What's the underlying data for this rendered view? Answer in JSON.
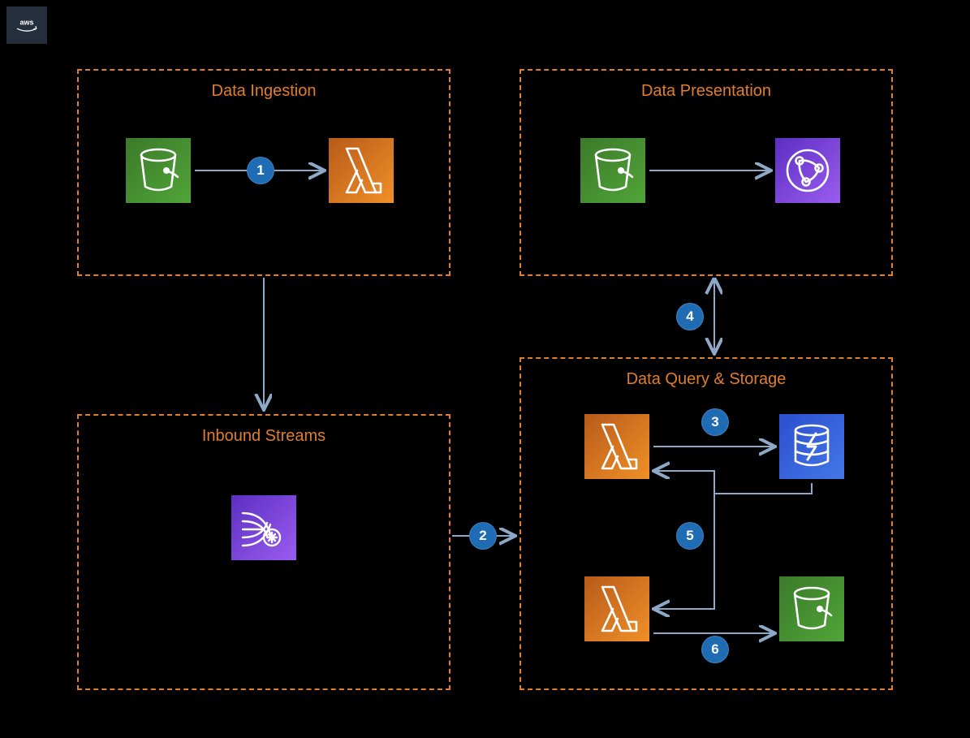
{
  "logo": {
    "name": "aws"
  },
  "groups": {
    "ingestion": {
      "title": "Data Ingestion"
    },
    "presentation": {
      "title": "Data Presentation"
    },
    "inbound": {
      "title": "Inbound Streams"
    },
    "query": {
      "title": "Data Query & Storage"
    }
  },
  "services": {
    "s3_ingest": {
      "icon": "s3",
      "name": "s3-bucket"
    },
    "lambda_ingest": {
      "icon": "lambda",
      "name": "lambda-function"
    },
    "s3_present": {
      "icon": "s3",
      "name": "s3-bucket"
    },
    "cloudfront": {
      "icon": "cloudfront",
      "name": "cloudfront-distribution"
    },
    "kinesis": {
      "icon": "kinesis",
      "name": "kinesis-data-stream"
    },
    "lambda_q1": {
      "icon": "lambda",
      "name": "lambda-function"
    },
    "dynamodb": {
      "icon": "dynamodb",
      "name": "dynamodb-table"
    },
    "lambda_q2": {
      "icon": "lambda",
      "name": "lambda-function"
    },
    "s3_store": {
      "icon": "s3",
      "name": "s3-bucket"
    }
  },
  "steps": {
    "n1": "1",
    "n2": "2",
    "n3": "3",
    "n4": "4",
    "n5": "5",
    "n6": "6"
  },
  "colors": {
    "group_border": "#e07e2c",
    "group_title": "#e07e2c",
    "arrow": "#8ea8c7",
    "step_circle": "#1f6cb4"
  }
}
